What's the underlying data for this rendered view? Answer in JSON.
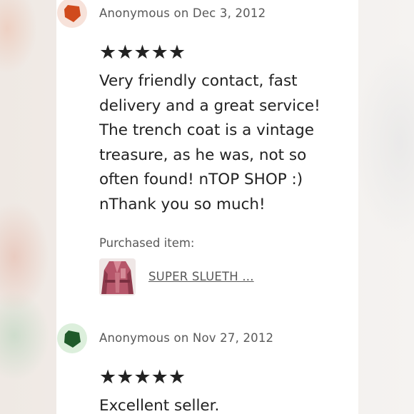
{
  "reviews": [
    {
      "avatar_color": "#d04a1c",
      "avatar_bg": "#f7e2da",
      "author": "Anonymous",
      "date_text": "Anonymous on Dec 3, 2012",
      "stars": "★★★★★",
      "rating": 5,
      "text": "Very friendly contact, fast delivery and a great service! The trench coat is a vintage treasure, as he was, not so often found! nTOP SHOP :) nThank you so much!",
      "purchased_label": "Purchased item:",
      "item_name": "SUPER SLUETH ...",
      "item_icon": "coat-thumbnail"
    },
    {
      "avatar_color": "#1f5a2a",
      "avatar_bg": "#dcefdc",
      "author": "Anonymous",
      "date_text": "Anonymous on Nov 27, 2012",
      "stars": "★★★★★",
      "rating": 5,
      "text": "Excellent seller."
    }
  ]
}
